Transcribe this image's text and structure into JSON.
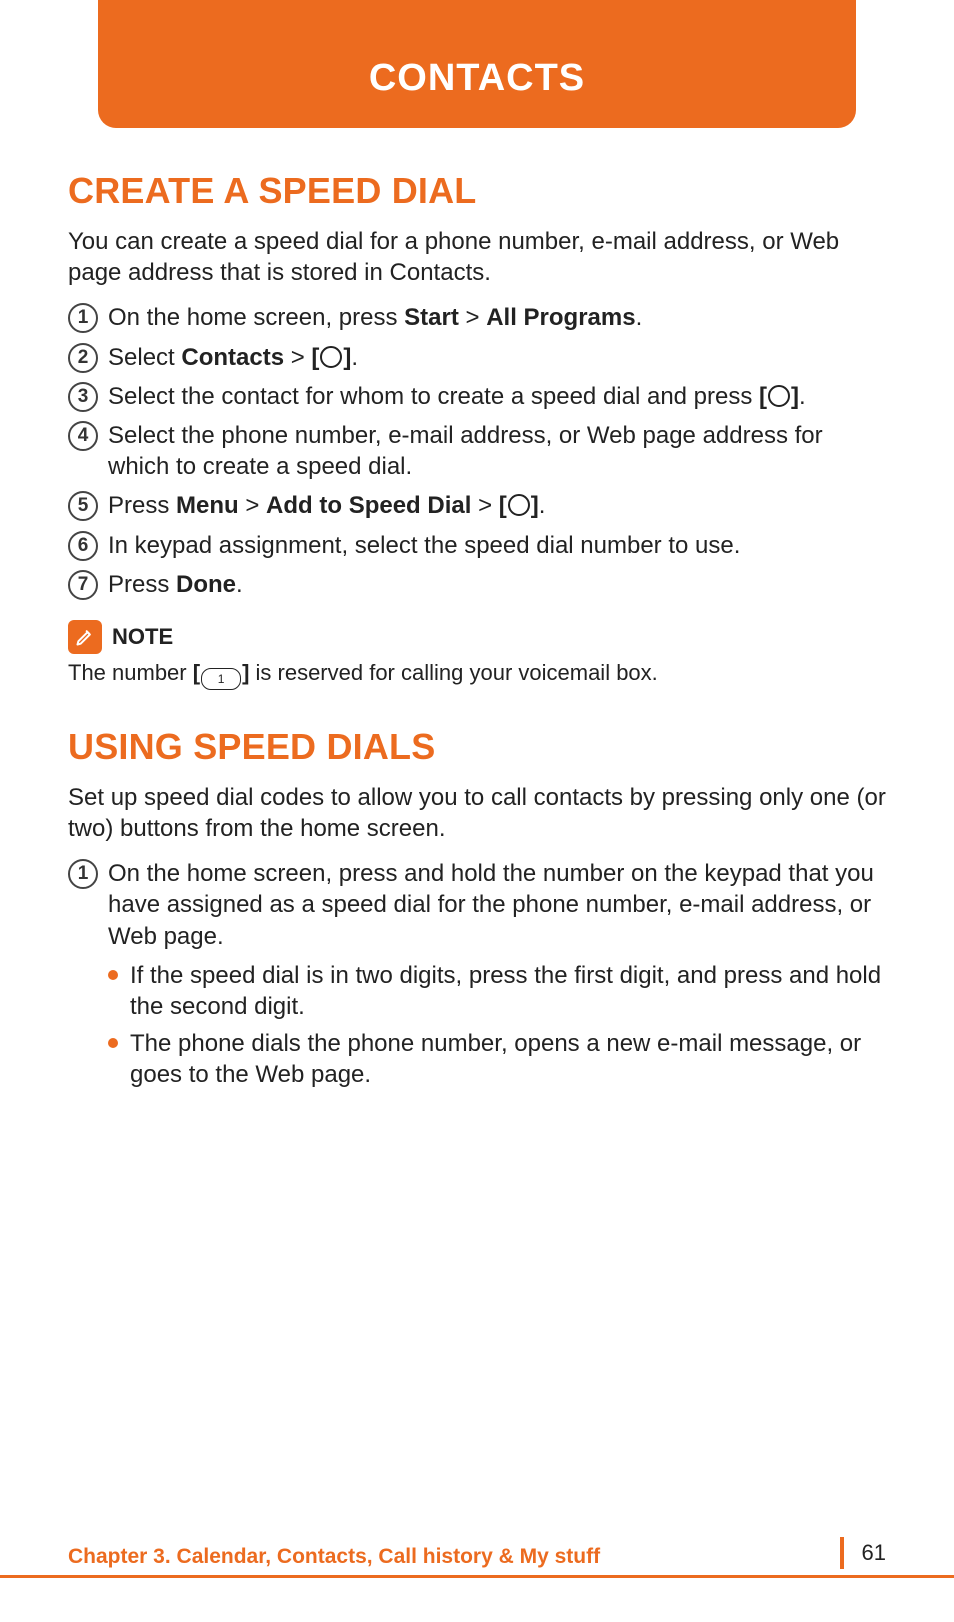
{
  "header": {
    "title": "CONTACTS"
  },
  "section1": {
    "heading": "CREATE A SPEED DIAL",
    "intro": "You can create a speed dial for a phone number, e-mail address, or Web page address that is stored in Contacts.",
    "s1_a": "On the home screen, press ",
    "s1_b": "Start",
    "s1_c": " > ",
    "s1_d": "All Programs",
    "s1_e": ".",
    "s2_a": "Select ",
    "s2_b": "Contacts",
    "s2_c": " > ",
    "s2_d": "[",
    "s2_e": "]",
    "s2_f": ".",
    "s3_a": "Select the contact for whom to create a speed dial and press ",
    "s3_b": "[",
    "s3_c": "]",
    "s3_d": ".",
    "s4": "Select the phone number, e-mail address, or Web page address for which to create a speed dial.",
    "s5_a": "Press ",
    "s5_b": "Menu",
    "s5_c": " > ",
    "s5_d": "Add to Speed Dial",
    "s5_e": " > ",
    "s5_f": "[",
    "s5_g": "]",
    "s5_h": ".",
    "s6": "In keypad assignment, select the speed dial number to use.",
    "s7_a": "Press ",
    "s7_b": "Done",
    "s7_c": "."
  },
  "note": {
    "label": "NOTE",
    "t1": "The number ",
    "t2": "[",
    "keycap": "1",
    "t3": "]",
    "t4": " is reserved for calling your voicemail box."
  },
  "section2": {
    "heading": "USING SPEED DIALS",
    "intro": "Set up speed dial codes to allow you to call contacts by pressing only one (or two) buttons from the home screen.",
    "s1": "On the home screen, press and hold the number on the keypad that you have assigned as a speed dial for the phone number, e-mail address, or Web page.",
    "b1": "If the speed dial is in two digits, press the first digit, and press and hold the second digit.",
    "b2": "The phone dials the phone number, opens a new e-mail message, or goes to the Web page."
  },
  "nums": {
    "n1": "1",
    "n2": "2",
    "n3": "3",
    "n4": "4",
    "n5": "5",
    "n6": "6",
    "n7": "7"
  },
  "footer": {
    "chapter": "Chapter 3. Calendar, Contacts, Call history & My stuff",
    "page_number": "61"
  }
}
